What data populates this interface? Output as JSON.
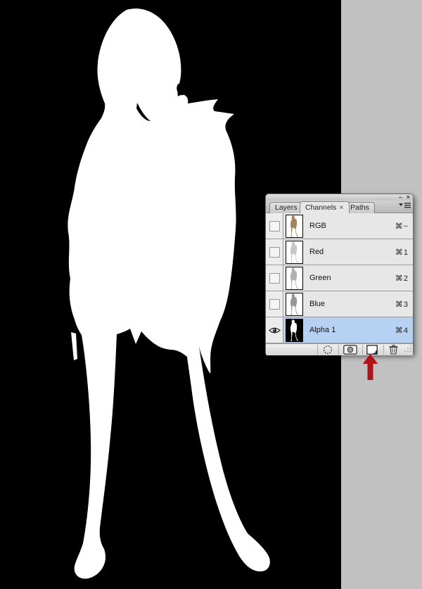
{
  "canvas": {
    "description": "Alpha 1 channel mask: white silhouette of a standing woman on black",
    "background": "#000000",
    "mask_color": "#ffffff",
    "desktop_color": "#c1c1c1"
  },
  "window": {
    "minimize_glyph": "–",
    "close_glyph": "×"
  },
  "panel": {
    "tabs": [
      {
        "label": "Layers",
        "active": false
      },
      {
        "label": "Channels",
        "active": true,
        "close_glyph": "×"
      },
      {
        "label": "Paths",
        "active": false
      }
    ],
    "channels": [
      {
        "name": "RGB",
        "shortcut": "⌘~",
        "thumb": "color-photo",
        "selected": false,
        "visible": false
      },
      {
        "name": "Red",
        "shortcut": "⌘1",
        "thumb": "grayscale-light",
        "selected": false,
        "visible": false
      },
      {
        "name": "Green",
        "shortcut": "⌘2",
        "thumb": "grayscale-mid",
        "selected": false,
        "visible": false
      },
      {
        "name": "Blue",
        "shortcut": "⌘3",
        "thumb": "grayscale-dark",
        "selected": false,
        "visible": false
      },
      {
        "name": "Alpha 1",
        "shortcut": "⌘4",
        "thumb": "alpha-mask",
        "selected": true,
        "visible": true
      }
    ],
    "selected_channel": "Alpha 1",
    "highlight_color": "#b6d1f2",
    "toolbar": [
      {
        "name": "load-channel-as-selection",
        "icon": "dashed-circle"
      },
      {
        "name": "save-selection-as-channel",
        "icon": "circle-in-square"
      },
      {
        "name": "create-new-channel",
        "icon": "new-page",
        "pointed_by_arrow": true
      },
      {
        "name": "delete-current-channel",
        "icon": "trash"
      }
    ]
  },
  "annotation": {
    "arrow_color": "#b01419",
    "points_to": "create-new-channel-button"
  }
}
